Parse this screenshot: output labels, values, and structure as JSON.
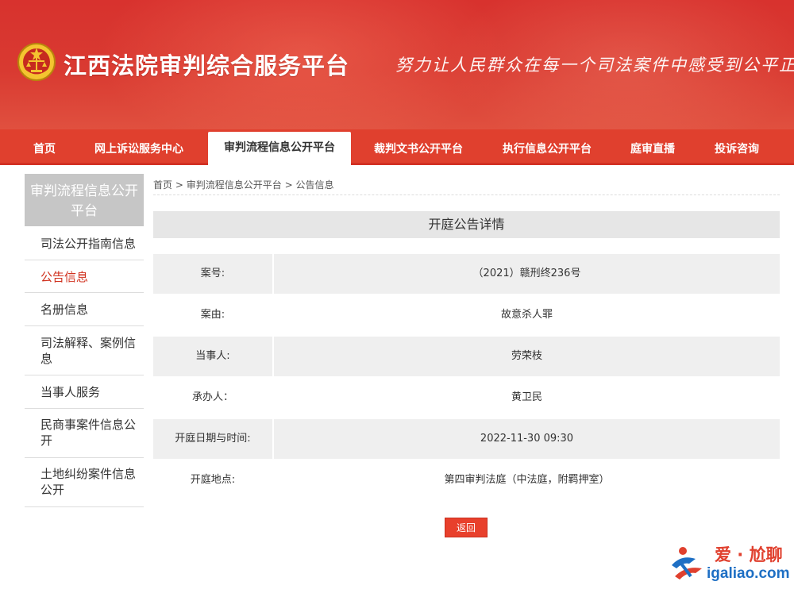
{
  "site": {
    "title": "江西法院审判综合服务平台",
    "slogan": "努力让人民群众在每一个司法案件中感受到公平正义"
  },
  "nav": {
    "items": [
      {
        "label": "首页"
      },
      {
        "label": "网上诉讼服务中心"
      },
      {
        "label": "审判流程信息公开平台",
        "active": true
      },
      {
        "label": "裁判文书公开平台"
      },
      {
        "label": "执行信息公开平台"
      },
      {
        "label": "庭审直播"
      },
      {
        "label": "投诉咨询"
      }
    ]
  },
  "sidebar": {
    "heading": "审判流程信息公开平台",
    "items": [
      {
        "label": "司法公开指南信息"
      },
      {
        "label": "公告信息",
        "active": true
      },
      {
        "label": "名册信息"
      },
      {
        "label": "司法解释、案例信息"
      },
      {
        "label": "当事人服务"
      },
      {
        "label": "民商事案件信息公开"
      },
      {
        "label": "土地纠纷案件信息公开"
      }
    ]
  },
  "breadcrumb": {
    "home": "首页",
    "sep": ">",
    "section": "审判流程信息公开平台",
    "current": "公告信息"
  },
  "detail": {
    "title": "开庭公告详情",
    "rows": [
      {
        "label": "案号:",
        "value": "（2021）赣刑终236号"
      },
      {
        "label": "案由:",
        "value": "故意杀人罪"
      },
      {
        "label": "当事人:",
        "value": "劳荣枝"
      },
      {
        "label": "承办人：",
        "value": "黄卫民"
      },
      {
        "label": "开庭日期与时间:",
        "value": "2022-11-30 09:30"
      },
      {
        "label": "开庭地点:",
        "value": "第四审判法庭（中法庭，附羁押室）"
      }
    ],
    "back_label": "返回"
  },
  "watermark": {
    "cn": "爱 · 尬聊",
    "en": "igaliao.com"
  },
  "colors": {
    "brand_red": "#e0402e",
    "accent_text": "#d0321f"
  }
}
